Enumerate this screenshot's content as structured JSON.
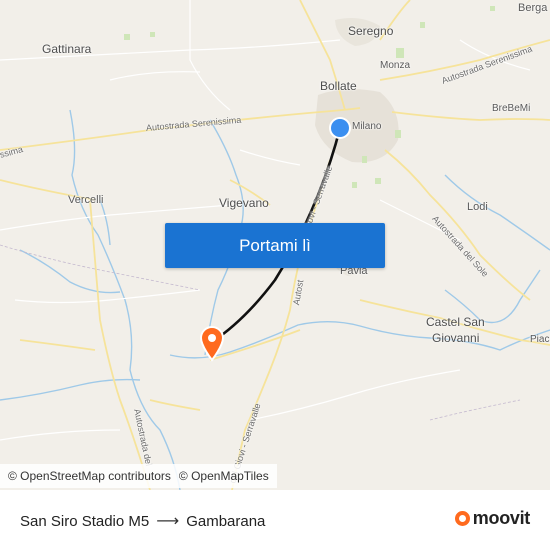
{
  "map": {
    "places": [
      {
        "id": "bergamo",
        "text": "Berga"
      },
      {
        "id": "gattinara",
        "text": "Gattinara"
      },
      {
        "id": "seregno",
        "text": "Seregno"
      },
      {
        "id": "monza",
        "text": "Monza"
      },
      {
        "id": "bollate",
        "text": "Bollate"
      },
      {
        "id": "milano",
        "text": "Milano"
      },
      {
        "id": "brebemi",
        "text": "BreBeMi"
      },
      {
        "id": "vercelli",
        "text": "Vercelli"
      },
      {
        "id": "vigevano",
        "text": "Vigevano"
      },
      {
        "id": "lodi",
        "text": "Lodi"
      },
      {
        "id": "pavia",
        "text": "Pavia"
      },
      {
        "id": "castel1",
        "text": "Castel San"
      },
      {
        "id": "castel2",
        "text": "Giovanni"
      },
      {
        "id": "piacenza",
        "text": "Piace"
      }
    ],
    "road_labels": [
      {
        "id": "serenissima-ne",
        "text": "Autostrada Serenissima"
      },
      {
        "id": "serenissima-c",
        "text": "Autostrada Serenissima"
      },
      {
        "id": "serenissima-w",
        "text": "ssima"
      },
      {
        "id": "giovi-serravalle-n",
        "text": "Giovi - Serravalle"
      },
      {
        "id": "autost-n",
        "text": "Autost"
      },
      {
        "id": "del-sole",
        "text": "Autostrada del Sole"
      },
      {
        "id": "giovi-serravalle-s",
        "text": "del Giovi - Serravalle"
      },
      {
        "id": "strada-del",
        "text": "Autostrada del"
      }
    ]
  },
  "cta_label": "Portami lì",
  "attribution": {
    "osm": "© OpenStreetMap contributors",
    "omt": "© OpenMapTiles"
  },
  "route": {
    "from": "San Siro Stadio M5",
    "arrow": "⟶",
    "to": "Gambarana"
  },
  "brand": "moovit",
  "colors": {
    "origin_marker": "#3b8ff0",
    "destination_marker": "#ff6a1e",
    "route_line": "#111111",
    "button": "#1a73d2"
  },
  "icons": {
    "origin": "origin-dot-icon",
    "destination": "destination-pin-icon",
    "brand": "moovit-logo-icon"
  }
}
